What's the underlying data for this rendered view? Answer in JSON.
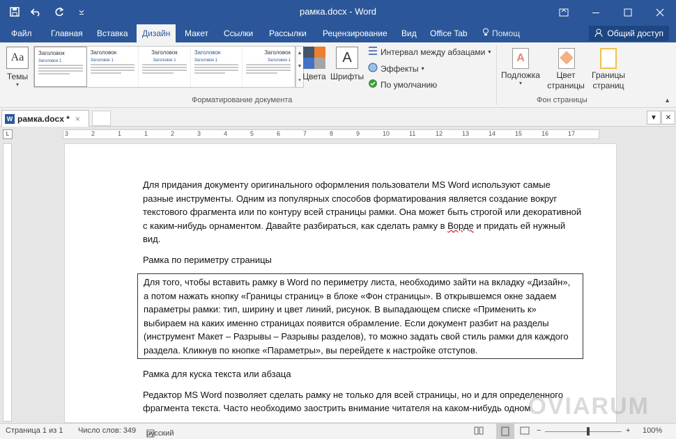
{
  "window": {
    "title": "рамка.docx - Word"
  },
  "tabs": [
    {
      "label": "Файл"
    },
    {
      "label": "Главная"
    },
    {
      "label": "Вставка"
    },
    {
      "label": "Дизайн"
    },
    {
      "label": "Макет"
    },
    {
      "label": "Ссылки"
    },
    {
      "label": "Рассылки"
    },
    {
      "label": "Рецензирование"
    },
    {
      "label": "Вид"
    },
    {
      "label": "Office Tab"
    },
    {
      "label": "Помощ"
    }
  ],
  "share_label": "Общий доступ",
  "ribbon": {
    "themes_label": "Темы",
    "gallery": [
      {
        "heading": "Заголовок",
        "sub": "Заголовок 1"
      },
      {
        "heading": "Заголовок",
        "sub": "Заголовок 1"
      },
      {
        "heading": "Заголовок",
        "sub": "Заголовок 1"
      },
      {
        "heading": "Заголовок",
        "sub": "Заголовок 1"
      },
      {
        "heading": "Заголовок",
        "sub": "Заголовок 1"
      },
      {
        "heading": "Заголовок",
        "sub": "Заголовок 1"
      }
    ],
    "colors_label": "Цвета",
    "fonts_label": "Шрифты",
    "spacing_label": "Интервал между абзацами",
    "effects_label": "Эффекты",
    "default_label": "По умолчанию",
    "group_format": "Форматирование документа",
    "watermark_label": "Подложка",
    "page_color_label": "Цвет страницы",
    "page_borders_label": "Границы страниц",
    "group_bg": "Фон страницы"
  },
  "doc_tab": {
    "label": "рамка.docx *"
  },
  "ruler_numbers": [
    "3",
    "2",
    "1",
    "1",
    "2",
    "3",
    "4",
    "5",
    "6",
    "7",
    "8",
    "9",
    "10",
    "11",
    "12",
    "13",
    "14",
    "15",
    "16",
    "17"
  ],
  "document": {
    "p1": "Для придания документу оригинального оформления пользователи MS Word используют самые разные инструменты. Одним из популярных способов форматирования является создание вокруг текстового фрагмента или по контуру всей страницы рамки. Она может быть строгой или декоративной с каким-нибудь орнаментом. Давайте разбираться, как сделать рамку в ",
    "p1_err": "Ворде",
    "p1_end": " и придать ей нужный вид.",
    "h1": "Рамка по периметру страницы",
    "p2": "Для того, чтобы вставить рамку в Word по периметру листа, необходимо зайти на вкладку «Дизайн», а потом нажать кнопку «Границы страниц» в блоке «Фон страницы». В открывшемся окне задаем параметры рамки: тип, ширину и цвет линий, рисунок. В выпадающем списке «Применить к» выбираем на каких именно страницах появится обрамление. Если документ разбит на разделы (инструмент Макет – Разрывы – Разрывы разделов), то можно задать свой стиль рамки для каждого раздела. Кликнув по кнопке «Параметры», вы перейдете к настройке отступов.",
    "h2": "Рамка для куска текста или абзаца",
    "p3": "Редактор MS Word позволяет сделать рамку не только для всей страницы, но и для определенного фрагмента текста. Часто необходимо заострить внимание читателя на каком-нибудь одном"
  },
  "status": {
    "page": "Страница 1 из 1",
    "words": "Число слов: 349",
    "lang": "русский",
    "zoom": "100%"
  },
  "watermark": "OVIARUM",
  "colors": {
    "accent": "#2b579a"
  }
}
